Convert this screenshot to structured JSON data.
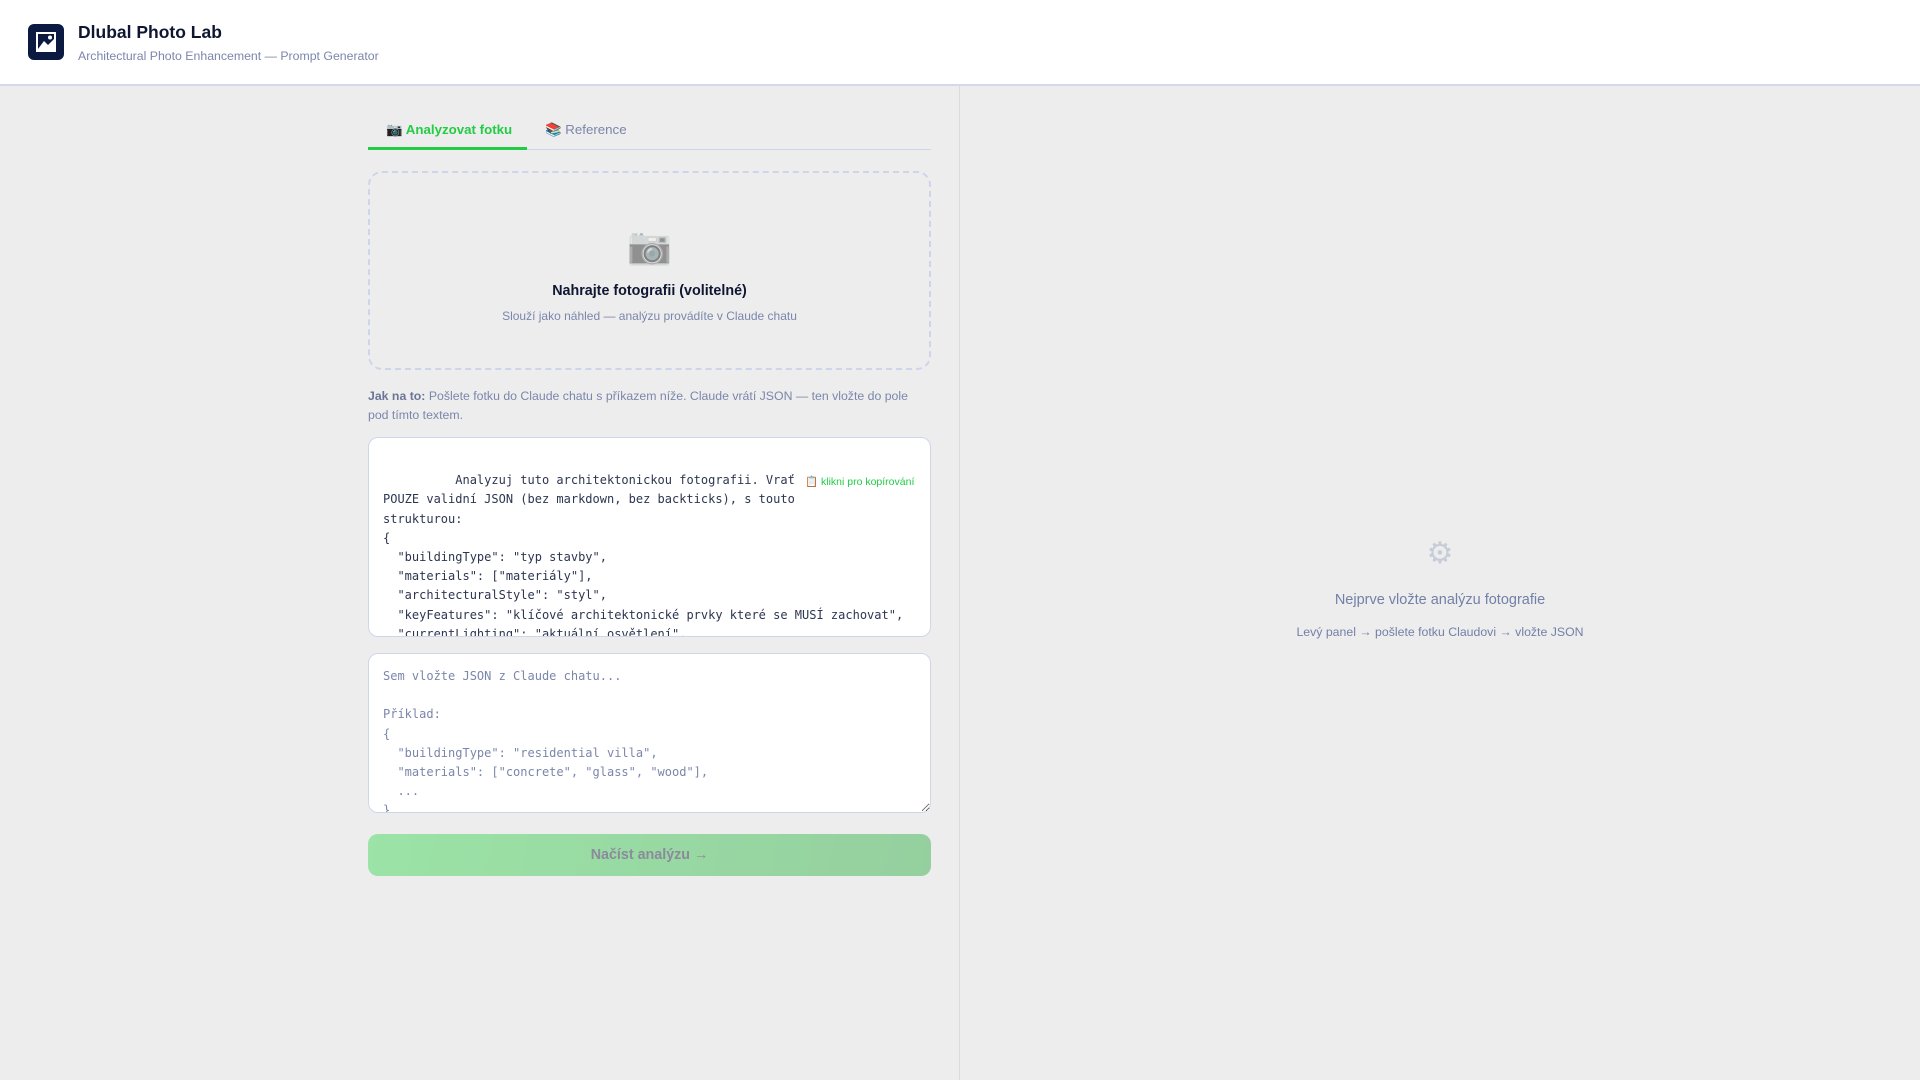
{
  "header": {
    "title": "Dlubal Photo Lab",
    "subtitle": "Architectural Photo Enhancement — Prompt Generator",
    "logo_icon": "image-icon"
  },
  "tabs": [
    {
      "label": "📷 Analyzovat fotku",
      "active": true
    },
    {
      "label": "📚 Reference",
      "active": false
    }
  ],
  "upload": {
    "icon": "📷",
    "title": "Nahrajte fotografii (volitelné)",
    "subtitle": "Slouží jako náhled — analýzu provádíte v Claude chatu"
  },
  "info": {
    "bold": "Jak na to:",
    "text": " Pošlete fotku do Claude chatu s příkazem níže. Claude vrátí JSON — ten vložte do pole pod tímto textem."
  },
  "prompt": {
    "copy_hint": "📋 klikni pro kopírování",
    "text": "\n          Analyzuj tuto architektonickou fotografii. Vrať\nPOUZE validní JSON (bez markdown, bez backticks), s touto\nstrukturou:\n{\n  \"buildingType\": \"typ stavby\",\n  \"materials\": [\"materiály\"],\n  \"architecturalStyle\": \"styl\",\n  \"keyFeatures\": \"klíčové architektonické prvky které se MUSÍ zachovat\",\n  \"currentLighting\": \"aktuální osvětlení\","
  },
  "json_input": {
    "value": "",
    "placeholder": "Sem vložte JSON z Claude chatu...\n\nPříklad:\n{\n  \"buildingType\": \"residential villa\",\n  \"materials\": [\"concrete\", \"glass\", \"wood\"],\n  ...\n}"
  },
  "load_button": {
    "label": "Načíst analýzu →",
    "disabled": true
  },
  "empty_state": {
    "icon": "⚙",
    "title": "Nejprve vložte analýzu fotografie",
    "subtitle": "Levý panel → pošlete fotku Claudovi → vložte JSON"
  }
}
